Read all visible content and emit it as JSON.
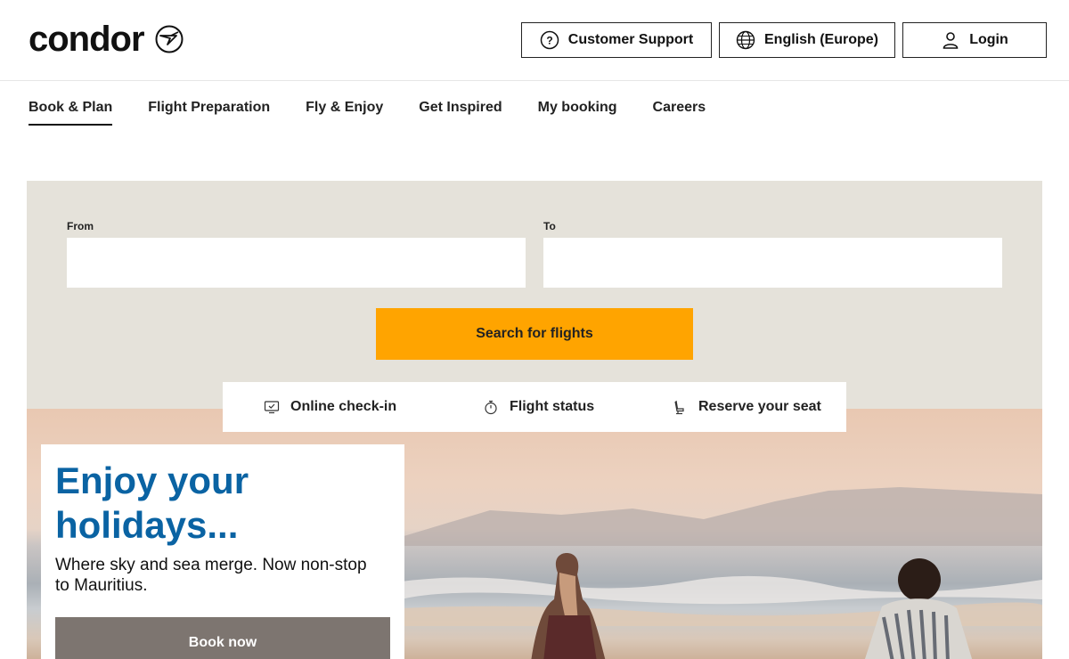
{
  "header": {
    "logo_text": "condor",
    "support_label": "Customer Support",
    "language_label": "English (Europe)",
    "login_label": "Login"
  },
  "nav": {
    "items": [
      {
        "label": "Book & Plan",
        "active": true
      },
      {
        "label": "Flight Preparation"
      },
      {
        "label": "Fly & Enjoy"
      },
      {
        "label": "Get Inspired"
      },
      {
        "label": "My booking"
      },
      {
        "label": "Careers"
      }
    ]
  },
  "search": {
    "from_label": "From",
    "from_value": "",
    "to_label": "To",
    "to_value": "",
    "button_label": "Search for flights"
  },
  "quick_links": {
    "checkin": "Online check-in",
    "status": "Flight status",
    "seat": "Reserve your seat"
  },
  "promo": {
    "title": "Enjoy your holidays...",
    "subtitle": "Where sky and sea merge. Now non-stop to Mauritius.",
    "button_label": "Book now"
  },
  "colors": {
    "accent": "#ffa400",
    "brand_blue": "#0a63a3",
    "panel_bg": "#e5e2da",
    "promo_button": "#7d7570"
  },
  "icons": {
    "support": "question-circle-icon",
    "language": "globe-icon",
    "login": "user-icon",
    "checkin": "monitor-check-icon",
    "status": "stopwatch-icon",
    "seat": "seat-icon"
  }
}
